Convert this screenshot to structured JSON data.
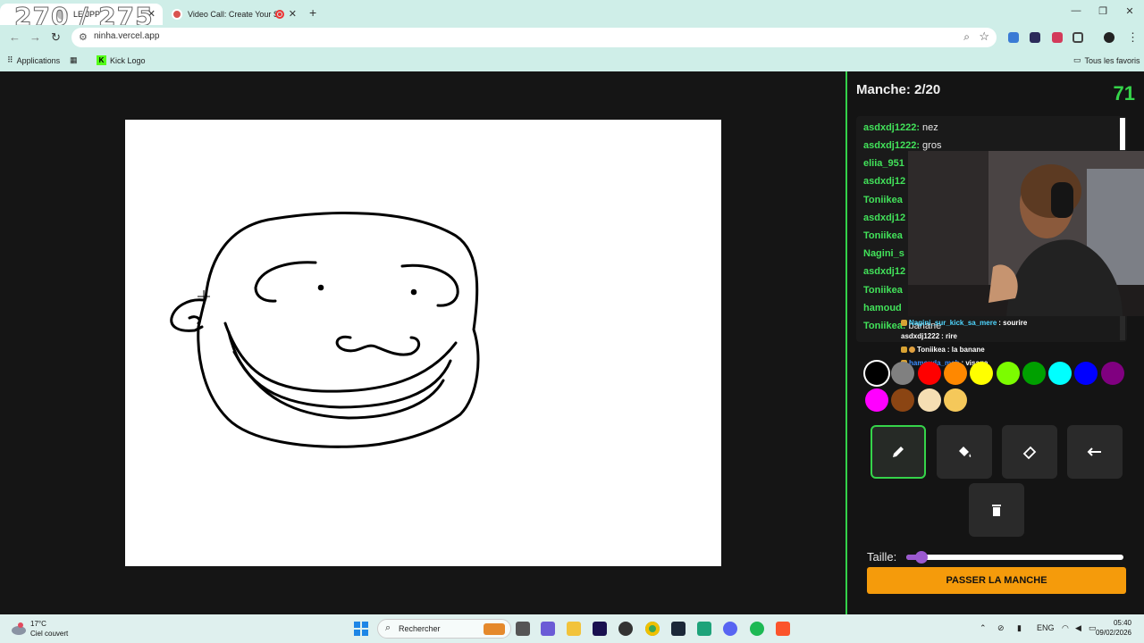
{
  "browser": {
    "overlay_counter": "270 / 275",
    "tabs": [
      {
        "title": "LE JPP",
        "active": true
      },
      {
        "title": "Video Call: Create Your Serv",
        "active": false
      }
    ],
    "new_tab": "+",
    "url": "ninha.vercel.app",
    "bookmarks": [
      {
        "label": "Applications"
      },
      {
        "label": "Kick Logo"
      }
    ],
    "all_bookmarks": "Tous les favoris",
    "window_controls": [
      "minimize",
      "restore",
      "close"
    ]
  },
  "game": {
    "round_label": "Manche: 2/20",
    "timer": "71",
    "chat": [
      {
        "user": "asdxdj1222:",
        "text": "nez"
      },
      {
        "user": "asdxdj1222:",
        "text": "gros"
      },
      {
        "user": "eliia_951",
        "text": ""
      },
      {
        "user": "asdxdj12",
        "text": ""
      },
      {
        "user": "Toniikea",
        "text": ""
      },
      {
        "user": "asdxdj12",
        "text": ""
      },
      {
        "user": "Toniikea",
        "text": ""
      },
      {
        "user": "Nagini_s",
        "text": ""
      },
      {
        "user": "asdxdj12",
        "text": ""
      },
      {
        "user": "Toniikea",
        "text": ""
      },
      {
        "user": "hamoud",
        "text": ""
      },
      {
        "user": "Toniikea:",
        "text": "banane"
      }
    ],
    "stream_chat": [
      {
        "user": "Nagini_sur_kick_sa_mere",
        "text": ": sourire",
        "user_color": "#4fd6ff"
      },
      {
        "user": "asdxdj1222",
        "text": ": rire",
        "user_color": "#ffffff"
      },
      {
        "user": "Toniikea",
        "text": ": la banane",
        "user_color": "#ffffff"
      },
      {
        "user": "hamouda_mab",
        "text": ": visage",
        "user_color": "#3b8cff"
      }
    ],
    "palette": [
      {
        "color": "#000000",
        "selected": true
      },
      {
        "color": "#808080"
      },
      {
        "color": "#ff0000"
      },
      {
        "color": "#ff8800"
      },
      {
        "color": "#ffff00"
      },
      {
        "color": "#7cfc00"
      },
      {
        "color": "#00a000"
      },
      {
        "color": "#00ffff"
      },
      {
        "color": "#0000ff"
      },
      {
        "color": "#800080"
      },
      {
        "color": "#ff00ff"
      },
      {
        "color": "#8b4513"
      },
      {
        "color": "#f5deb3"
      },
      {
        "color": "#f5c85a"
      }
    ],
    "tools": [
      {
        "name": "pencil-icon",
        "active": true
      },
      {
        "name": "fill-bucket-icon"
      },
      {
        "name": "eraser-icon"
      },
      {
        "name": "undo-icon"
      },
      {
        "name": "trash-icon"
      }
    ],
    "size_label": "Taille:",
    "size_value": 0.07,
    "skip_button": "PASSER LA MANCHE",
    "accent": "#35d44a"
  },
  "taskbar": {
    "temperature": "17°C",
    "weather": "Ciel couvert",
    "search": "Rechercher",
    "language": "ENG",
    "time": "05:40",
    "date": "09/02/2026"
  }
}
